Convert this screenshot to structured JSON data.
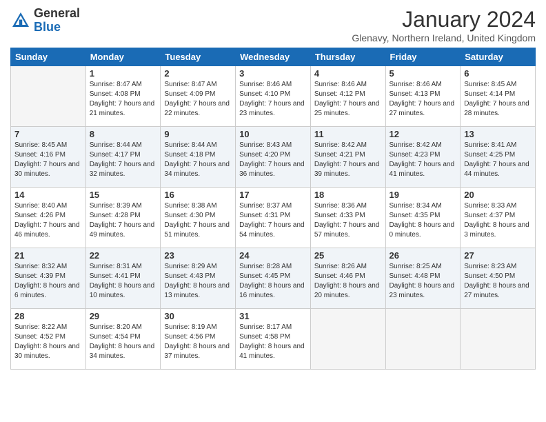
{
  "header": {
    "logo_general": "General",
    "logo_blue": "Blue",
    "month_title": "January 2024",
    "subtitle": "Glenavy, Northern Ireland, United Kingdom"
  },
  "weekdays": [
    "Sunday",
    "Monday",
    "Tuesday",
    "Wednesday",
    "Thursday",
    "Friday",
    "Saturday"
  ],
  "weeks": [
    [
      {
        "day": "",
        "sunrise": "",
        "sunset": "",
        "daylight": ""
      },
      {
        "day": "1",
        "sunrise": "Sunrise: 8:47 AM",
        "sunset": "Sunset: 4:08 PM",
        "daylight": "Daylight: 7 hours and 21 minutes."
      },
      {
        "day": "2",
        "sunrise": "Sunrise: 8:47 AM",
        "sunset": "Sunset: 4:09 PM",
        "daylight": "Daylight: 7 hours and 22 minutes."
      },
      {
        "day": "3",
        "sunrise": "Sunrise: 8:46 AM",
        "sunset": "Sunset: 4:10 PM",
        "daylight": "Daylight: 7 hours and 23 minutes."
      },
      {
        "day": "4",
        "sunrise": "Sunrise: 8:46 AM",
        "sunset": "Sunset: 4:12 PM",
        "daylight": "Daylight: 7 hours and 25 minutes."
      },
      {
        "day": "5",
        "sunrise": "Sunrise: 8:46 AM",
        "sunset": "Sunset: 4:13 PM",
        "daylight": "Daylight: 7 hours and 27 minutes."
      },
      {
        "day": "6",
        "sunrise": "Sunrise: 8:45 AM",
        "sunset": "Sunset: 4:14 PM",
        "daylight": "Daylight: 7 hours and 28 minutes."
      }
    ],
    [
      {
        "day": "7",
        "sunrise": "Sunrise: 8:45 AM",
        "sunset": "Sunset: 4:16 PM",
        "daylight": "Daylight: 7 hours and 30 minutes."
      },
      {
        "day": "8",
        "sunrise": "Sunrise: 8:44 AM",
        "sunset": "Sunset: 4:17 PM",
        "daylight": "Daylight: 7 hours and 32 minutes."
      },
      {
        "day": "9",
        "sunrise": "Sunrise: 8:44 AM",
        "sunset": "Sunset: 4:18 PM",
        "daylight": "Daylight: 7 hours and 34 minutes."
      },
      {
        "day": "10",
        "sunrise": "Sunrise: 8:43 AM",
        "sunset": "Sunset: 4:20 PM",
        "daylight": "Daylight: 7 hours and 36 minutes."
      },
      {
        "day": "11",
        "sunrise": "Sunrise: 8:42 AM",
        "sunset": "Sunset: 4:21 PM",
        "daylight": "Daylight: 7 hours and 39 minutes."
      },
      {
        "day": "12",
        "sunrise": "Sunrise: 8:42 AM",
        "sunset": "Sunset: 4:23 PM",
        "daylight": "Daylight: 7 hours and 41 minutes."
      },
      {
        "day": "13",
        "sunrise": "Sunrise: 8:41 AM",
        "sunset": "Sunset: 4:25 PM",
        "daylight": "Daylight: 7 hours and 44 minutes."
      }
    ],
    [
      {
        "day": "14",
        "sunrise": "Sunrise: 8:40 AM",
        "sunset": "Sunset: 4:26 PM",
        "daylight": "Daylight: 7 hours and 46 minutes."
      },
      {
        "day": "15",
        "sunrise": "Sunrise: 8:39 AM",
        "sunset": "Sunset: 4:28 PM",
        "daylight": "Daylight: 7 hours and 49 minutes."
      },
      {
        "day": "16",
        "sunrise": "Sunrise: 8:38 AM",
        "sunset": "Sunset: 4:30 PM",
        "daylight": "Daylight: 7 hours and 51 minutes."
      },
      {
        "day": "17",
        "sunrise": "Sunrise: 8:37 AM",
        "sunset": "Sunset: 4:31 PM",
        "daylight": "Daylight: 7 hours and 54 minutes."
      },
      {
        "day": "18",
        "sunrise": "Sunrise: 8:36 AM",
        "sunset": "Sunset: 4:33 PM",
        "daylight": "Daylight: 7 hours and 57 minutes."
      },
      {
        "day": "19",
        "sunrise": "Sunrise: 8:34 AM",
        "sunset": "Sunset: 4:35 PM",
        "daylight": "Daylight: 8 hours and 0 minutes."
      },
      {
        "day": "20",
        "sunrise": "Sunrise: 8:33 AM",
        "sunset": "Sunset: 4:37 PM",
        "daylight": "Daylight: 8 hours and 3 minutes."
      }
    ],
    [
      {
        "day": "21",
        "sunrise": "Sunrise: 8:32 AM",
        "sunset": "Sunset: 4:39 PM",
        "daylight": "Daylight: 8 hours and 6 minutes."
      },
      {
        "day": "22",
        "sunrise": "Sunrise: 8:31 AM",
        "sunset": "Sunset: 4:41 PM",
        "daylight": "Daylight: 8 hours and 10 minutes."
      },
      {
        "day": "23",
        "sunrise": "Sunrise: 8:29 AM",
        "sunset": "Sunset: 4:43 PM",
        "daylight": "Daylight: 8 hours and 13 minutes."
      },
      {
        "day": "24",
        "sunrise": "Sunrise: 8:28 AM",
        "sunset": "Sunset: 4:45 PM",
        "daylight": "Daylight: 8 hours and 16 minutes."
      },
      {
        "day": "25",
        "sunrise": "Sunrise: 8:26 AM",
        "sunset": "Sunset: 4:46 PM",
        "daylight": "Daylight: 8 hours and 20 minutes."
      },
      {
        "day": "26",
        "sunrise": "Sunrise: 8:25 AM",
        "sunset": "Sunset: 4:48 PM",
        "daylight": "Daylight: 8 hours and 23 minutes."
      },
      {
        "day": "27",
        "sunrise": "Sunrise: 8:23 AM",
        "sunset": "Sunset: 4:50 PM",
        "daylight": "Daylight: 8 hours and 27 minutes."
      }
    ],
    [
      {
        "day": "28",
        "sunrise": "Sunrise: 8:22 AM",
        "sunset": "Sunset: 4:52 PM",
        "daylight": "Daylight: 8 hours and 30 minutes."
      },
      {
        "day": "29",
        "sunrise": "Sunrise: 8:20 AM",
        "sunset": "Sunset: 4:54 PM",
        "daylight": "Daylight: 8 hours and 34 minutes."
      },
      {
        "day": "30",
        "sunrise": "Sunrise: 8:19 AM",
        "sunset": "Sunset: 4:56 PM",
        "daylight": "Daylight: 8 hours and 37 minutes."
      },
      {
        "day": "31",
        "sunrise": "Sunrise: 8:17 AM",
        "sunset": "Sunset: 4:58 PM",
        "daylight": "Daylight: 8 hours and 41 minutes."
      },
      {
        "day": "",
        "sunrise": "",
        "sunset": "",
        "daylight": ""
      },
      {
        "day": "",
        "sunrise": "",
        "sunset": "",
        "daylight": ""
      },
      {
        "day": "",
        "sunrise": "",
        "sunset": "",
        "daylight": ""
      }
    ]
  ]
}
